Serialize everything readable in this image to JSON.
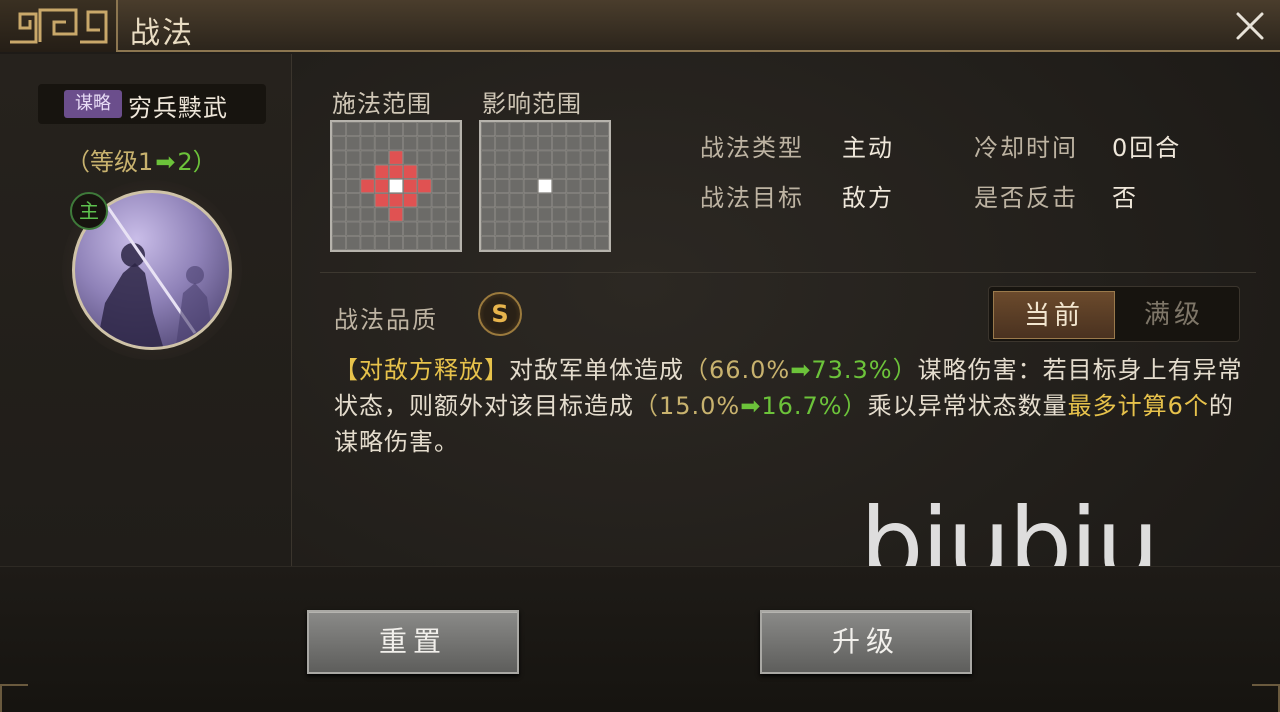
{
  "window": {
    "title": "战法",
    "close_icon": "close-icon"
  },
  "skill": {
    "type_tag": "谋略",
    "name": "穷兵黩武",
    "level_open": "（等级1",
    "level_to": "2）",
    "main_badge": "主"
  },
  "ranges": {
    "cast_label": "施法范围",
    "effect_label": "影响范围"
  },
  "info": {
    "type_label": "战法类型",
    "type_value": "主动",
    "cooldown_label": "冷却时间",
    "cooldown_value": "0回合",
    "target_label": "战法目标",
    "target_value": "敌方",
    "counter_label": "是否反击",
    "counter_value": "否"
  },
  "quality": {
    "label": "战法品质",
    "grade": "S"
  },
  "toggle": {
    "current": "当前",
    "max": "满级",
    "selected": "current"
  },
  "description": {
    "trigger": "【对敌方释放】",
    "p1": "对敌军单体造成",
    "val1_open": "（66.0%",
    "val1_new": "73.3%）",
    "p2": "谋略伤害：若目标身上有异常状态，则额外对该目标造成",
    "val2_open": "（15.0%",
    "val2_new": "16.7%）",
    "p3": "乘以异常状态数量",
    "p4": "最多计算6个",
    "p5": "的谋略伤害。"
  },
  "watermark": "biubiu",
  "buttons": {
    "reset": "重置",
    "upgrade": "升级"
  },
  "colors": {
    "accent_gold": "#e7c24b",
    "upgrade_green": "#6cc33a",
    "cast_cell_red": "#e05252",
    "strategy_purple": "#6b4e8c"
  }
}
